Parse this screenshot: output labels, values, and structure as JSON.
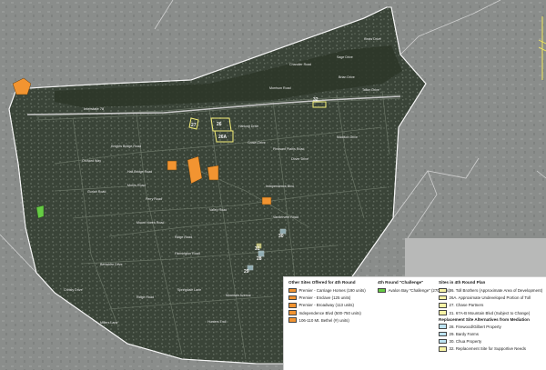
{
  "map": {
    "highway_label": "Interstate 78",
    "road_labels": [
      "Sage Drive",
      "Keats Drive",
      "Chandler Road",
      "Morrison Road",
      "Brian Drive",
      "Tallon Drive",
      "Hartung Drive",
      "Crown Drive",
      "Pleasant Plains Road",
      "Madison Drive",
      "Orchard Way",
      "Knights Bridge Road",
      "Hall Bridge Road",
      "Morris Road",
      "Valley Road",
      "Mount Horeb Road",
      "Independence Blvd",
      "Ridge Road",
      "Farmington Road",
      "Berkshire Drive",
      "Springdale Lane",
      "Ridge Road",
      "Hunters Trail",
      "Mountain Avenue",
      "Christy Drive",
      "Dover Drive",
      "Vanderveer Road",
      "Ferry Road",
      "Gurlan Road",
      "Millers Lane"
    ],
    "site_labels": [
      "26",
      "26A",
      "27",
      "28",
      "29",
      "30",
      "31",
      "32"
    ]
  },
  "legend": {
    "col1": {
      "title": "Other Sites Offered for 4th Round",
      "items": [
        {
          "label": "Premier - Carriage Homes (190 units)",
          "color": "#f29431"
        },
        {
          "label": "Premier - Enclave (125 units)",
          "color": "#f29431"
        },
        {
          "label": "Premier - Broadway (113 units)",
          "color": "#f29431"
        },
        {
          "label": "Independence Blvd (500-750 units)",
          "color": "#f29431"
        },
        {
          "label": "106-110 Mt. Bethel (#) units)",
          "color": "#f29431"
        }
      ]
    },
    "col2": {
      "title": "4th Round \"Challenge\"",
      "items": [
        {
          "label": "Avalon Bay \"Challenge\" (270 units)",
          "color": "#66cc44"
        }
      ]
    },
    "col3": {
      "title": "Sites in 4th Round Plan",
      "items": [
        {
          "label": "26. Toll Brothers (Approximate Area of Development)",
          "color": "#f7f3a6"
        },
        {
          "label": "26A. Approximate Undeveloped Portion of Toll",
          "color": "#f7f3a6"
        },
        {
          "label": "27. Chase Partners",
          "color": "#f7f3a6"
        },
        {
          "label": "31. 67A-B Mountain Blvd (Subject to Change)",
          "color": "#f7f3a6"
        }
      ],
      "subtitle": "Replacement Site Alternatives from Mediation",
      "items2": [
        {
          "label": "28. Firewood/Gilbert Property",
          "color": "#bde3f2"
        },
        {
          "label": "29. Bardy Farms",
          "color": "#bde3f2"
        },
        {
          "label": "30. Chua Property",
          "color": "#bde3f2"
        },
        {
          "label": "32. Replacement Site for Supportive Needs",
          "color": "#f7f3a6"
        }
      ]
    }
  }
}
